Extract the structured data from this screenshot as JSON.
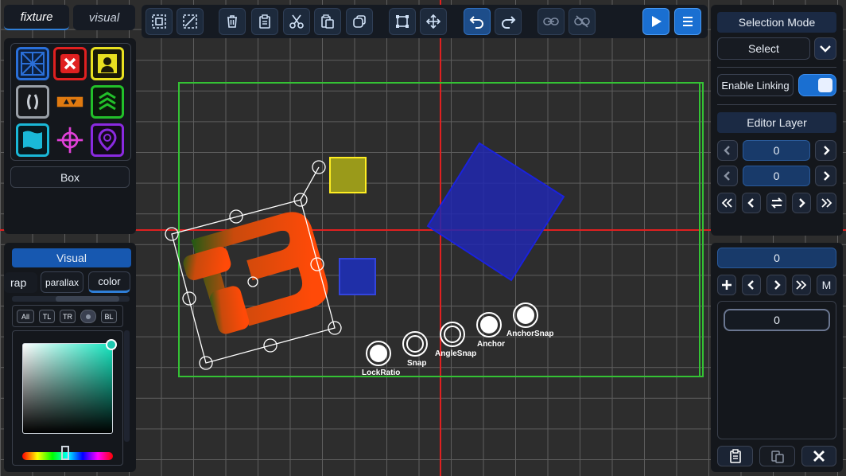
{
  "left_tabs": {
    "fixture": "fixture",
    "visual": "visual"
  },
  "fixture_panel": {
    "icons": [
      "grid-icon",
      "close-icon",
      "person-icon",
      "parentheses-icon",
      "arrows-icon",
      "chevrons-icon",
      "flag-icon",
      "crosshair-icon",
      "pin-icon"
    ],
    "selected_name": "Box"
  },
  "visual_panel": {
    "header": "Visual",
    "tabs": [
      "rap",
      "parallax",
      "color"
    ],
    "anchor_chips": [
      "All",
      "TL",
      "TR",
      "BL"
    ]
  },
  "snap_labels": {
    "lock_ratio": "LockRatio",
    "snap": "Snap",
    "angle_snap": "AngleSnap",
    "anchor": "Anchor",
    "anchor_snap": "AnchorSnap"
  },
  "right_panel": {
    "selection_mode_title": "Selection Mode",
    "selection_mode_value": "Select",
    "enable_linking_label": "Enable Linking",
    "editor_layer_title": "Editor Layer",
    "layer_value_1": "0",
    "layer_value_2": "0",
    "count_value": "0",
    "m_label": "M",
    "list_value": "0"
  },
  "colors": {
    "panel_bg": "#14171c",
    "accent_blue": "#1a6fd1",
    "grid_line": "#5b5b5b",
    "axis_red": "#e02020",
    "bounds_green": "#34c234",
    "yellow_box": "#9a9a1a",
    "blue_box": "#1f2fa8"
  }
}
